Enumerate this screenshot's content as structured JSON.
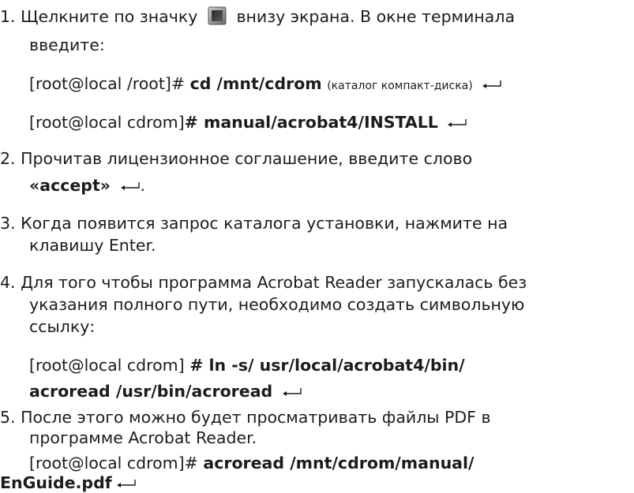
{
  "steps": [
    {
      "number": "1.",
      "text_before_icon": "Щелкните по значку",
      "text_after_icon": "внизу экрана. В окне терминала",
      "text_line2": "введите:",
      "icon": "terminal-icon",
      "commands": [
        {
          "prompt": "[root@local /root]#",
          "command": "cd /mnt/cdrom",
          "comment": "(каталог компакт-диска)"
        },
        {
          "prompt": "[root@local cdrom]",
          "command": "# manual/acrobat4/INSTALL"
        }
      ]
    },
    {
      "number": "2.",
      "line1": "Прочитав лицензионное соглашение, введите слово",
      "keyword": "«accept»",
      "trailing": "."
    },
    {
      "number": "3.",
      "line1": "Когда появится запрос каталога установки, нажмите на",
      "line2": "клавишу Enter."
    },
    {
      "number": "4.",
      "line1": "Для того чтобы программа Acrobat Reader запускалась без",
      "line2": "указания полного пути, необходимо создать символьную",
      "line3": "ссылку:",
      "command": {
        "prompt": "[root@local cdrom]",
        "part1": "# ln -s/ usr/local/acrobat4/bin/",
        "part2": "acroread /usr/bin/acroread"
      }
    },
    {
      "number": "5.",
      "line1": "После этого можно будет просматривать файлы PDF в",
      "line2": "программе Acrobat Reader.",
      "command": {
        "prompt": "[root@local cdrom]#",
        "part1": "acroread /mnt/cdrom/manual/",
        "part2": "EnGuide.pdf"
      }
    }
  ],
  "enter_symbol": "enter-key-icon"
}
